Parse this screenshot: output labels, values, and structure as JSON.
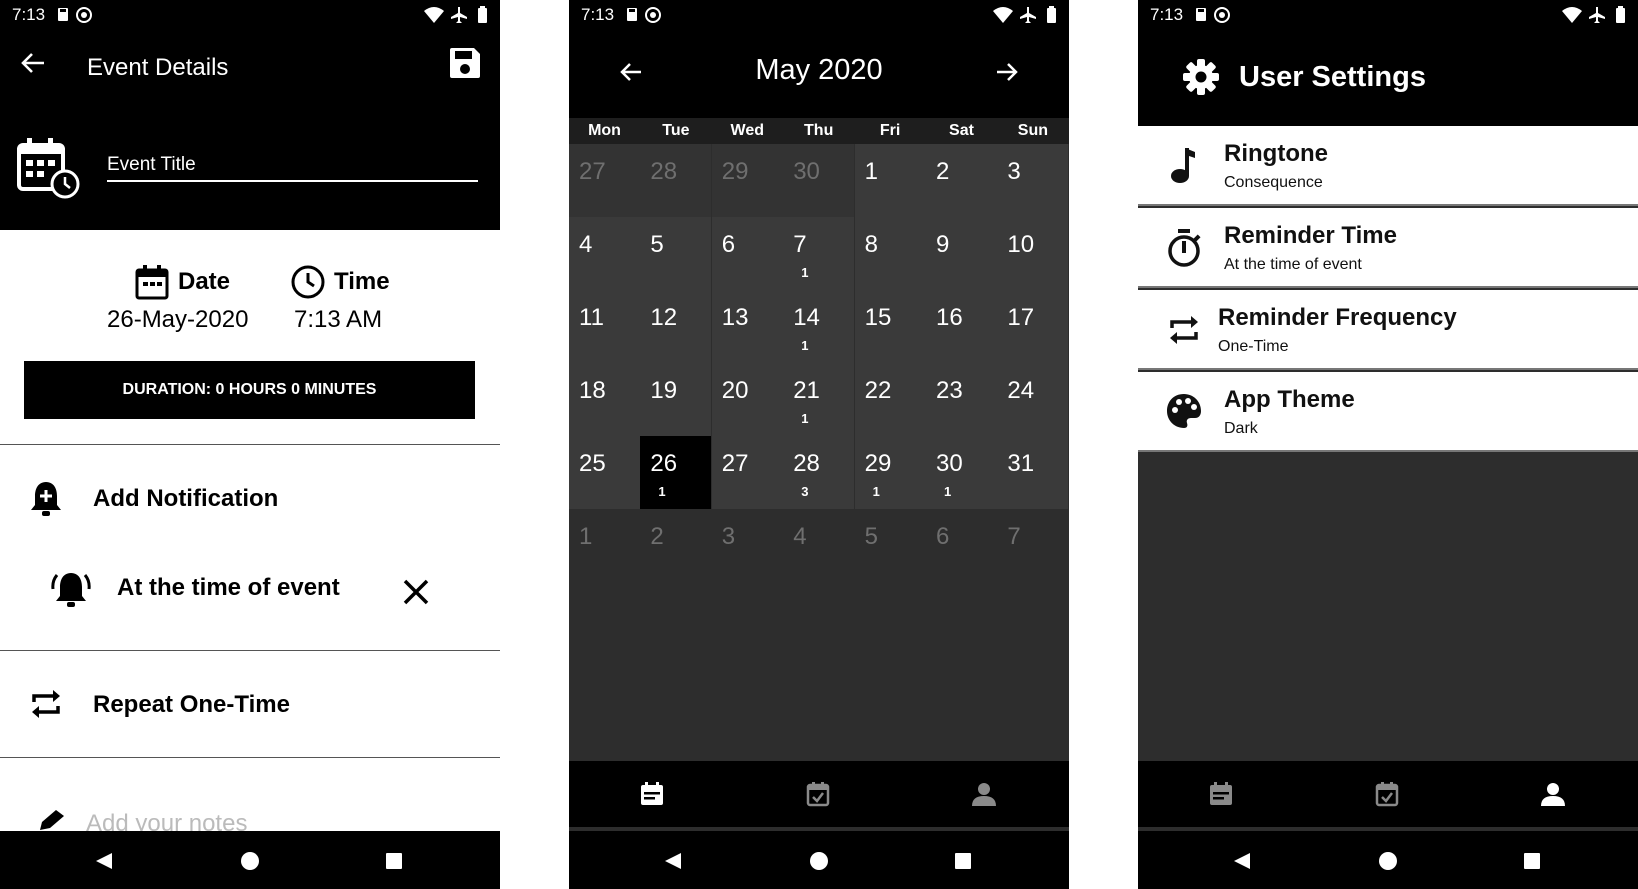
{
  "status": {
    "time": "7:13"
  },
  "event_details": {
    "title": "Event Details",
    "event_title_placeholder": "Event Title",
    "date_label": "Date",
    "date_value": "26-May-2020",
    "time_label": "Time",
    "time_value": "7:13 AM",
    "duration": "DURATION: 0 HOURS 0 MINUTES",
    "add_notification": "Add Notification",
    "notification_item": "At the time of event",
    "repeat": "Repeat One-Time",
    "notes_placeholder": "Add your notes"
  },
  "calendar": {
    "month_title": "May 2020",
    "weekdays": [
      "Mon",
      "Tue",
      "Wed",
      "Thu",
      "Fri",
      "Sat",
      "Sun"
    ],
    "weeks": [
      [
        {
          "d": "27",
          "out": true
        },
        {
          "d": "28",
          "out": true
        },
        {
          "d": "29",
          "out": true
        },
        {
          "d": "30",
          "out": true
        },
        {
          "d": "1"
        },
        {
          "d": "2"
        },
        {
          "d": "3"
        }
      ],
      [
        {
          "d": "4"
        },
        {
          "d": "5"
        },
        {
          "d": "6"
        },
        {
          "d": "7",
          "c": "1"
        },
        {
          "d": "8"
        },
        {
          "d": "9"
        },
        {
          "d": "10"
        }
      ],
      [
        {
          "d": "11"
        },
        {
          "d": "12"
        },
        {
          "d": "13"
        },
        {
          "d": "14",
          "c": "1"
        },
        {
          "d": "15"
        },
        {
          "d": "16"
        },
        {
          "d": "17"
        }
      ],
      [
        {
          "d": "18"
        },
        {
          "d": "19"
        },
        {
          "d": "20"
        },
        {
          "d": "21",
          "c": "1"
        },
        {
          "d": "22"
        },
        {
          "d": "23"
        },
        {
          "d": "24"
        }
      ],
      [
        {
          "d": "25"
        },
        {
          "d": "26",
          "c": "1",
          "selected": true
        },
        {
          "d": "27"
        },
        {
          "d": "28",
          "c": "3"
        },
        {
          "d": "29",
          "c": "1"
        },
        {
          "d": "30",
          "c": "1"
        },
        {
          "d": "31"
        }
      ],
      [
        {
          "d": "1",
          "out": true
        },
        {
          "d": "2",
          "out": true
        },
        {
          "d": "3",
          "out": true
        },
        {
          "d": "4",
          "out": true
        },
        {
          "d": "5",
          "out": true
        },
        {
          "d": "6",
          "out": true
        },
        {
          "d": "7",
          "out": true
        }
      ]
    ]
  },
  "settings": {
    "title": "User Settings",
    "items": [
      {
        "title": "Ringtone",
        "subtitle": "Consequence",
        "icon": "music-note-icon"
      },
      {
        "title": "Reminder Time",
        "subtitle": "At the time of event",
        "icon": "timer-icon"
      },
      {
        "title": "Reminder Frequency",
        "subtitle": "One-Time",
        "icon": "repeat-icon"
      },
      {
        "title": "App Theme",
        "subtitle": "Dark",
        "icon": "palette-icon"
      }
    ]
  },
  "colors": {
    "accent": "#000000",
    "cal_bg": "#3a3a3a",
    "muted_cell": "#333333",
    "out_text": "#6f6f6f"
  }
}
